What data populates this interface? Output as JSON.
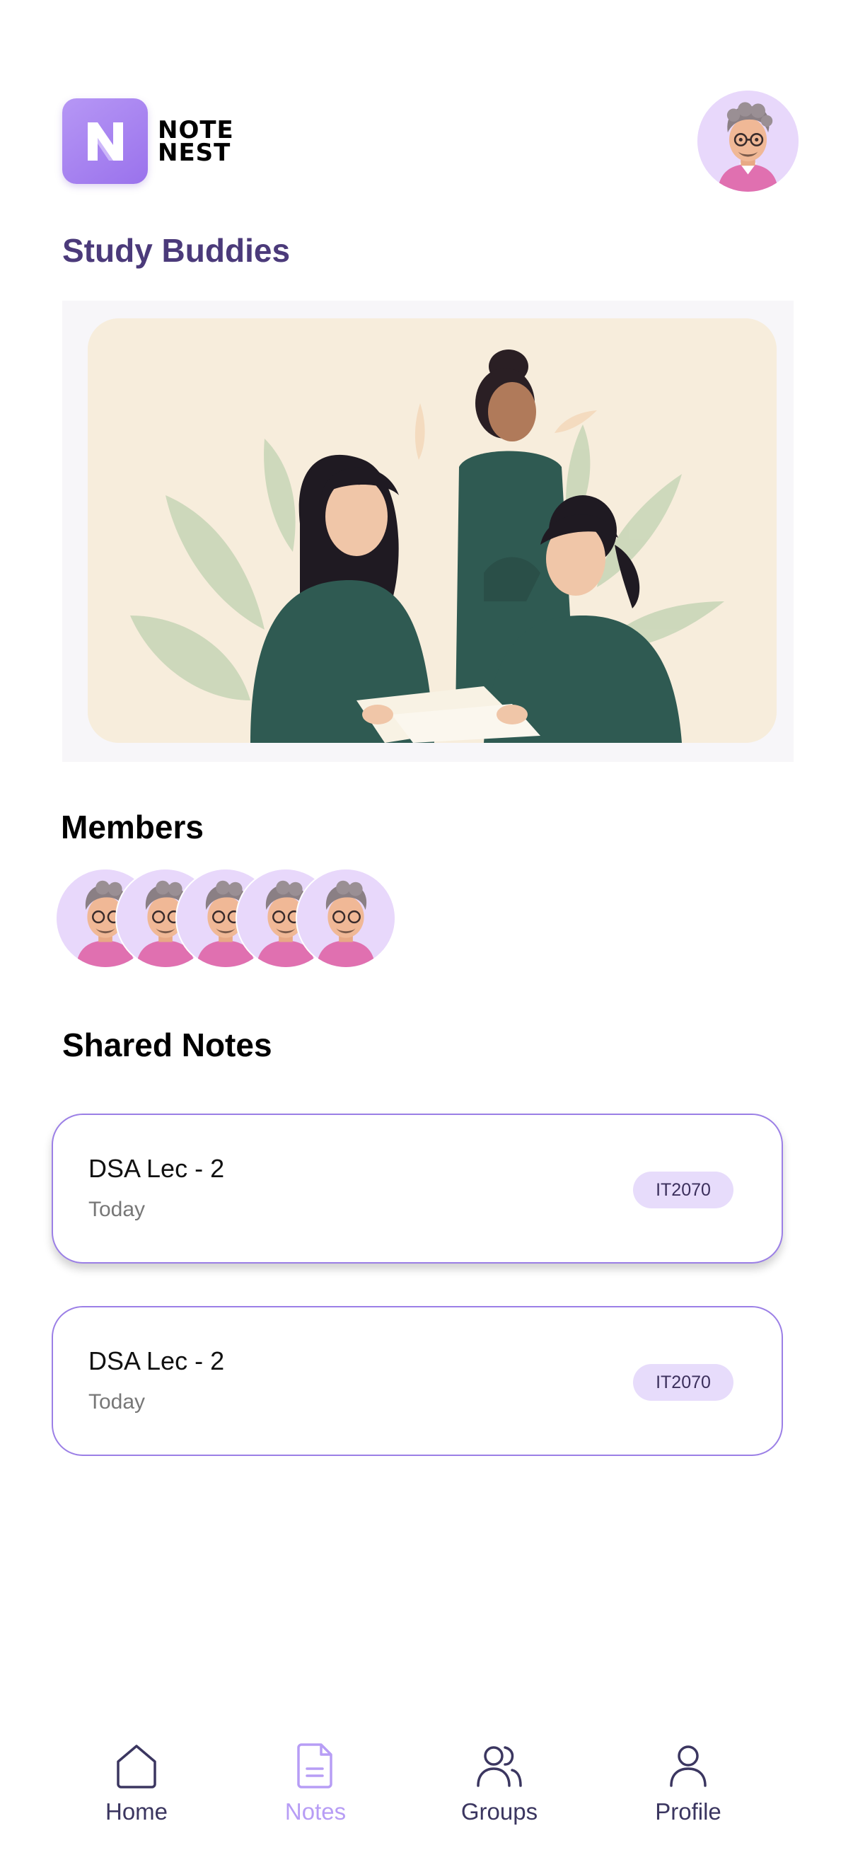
{
  "app": {
    "logo_line1": "NOTE",
    "logo_line2": "NEST",
    "logo_letter": "N"
  },
  "group": {
    "title": "Study Buddies"
  },
  "members": {
    "title": "Members",
    "count": 5
  },
  "shared_notes": {
    "title": "Shared Notes",
    "items": [
      {
        "name": "DSA Lec - 2",
        "date": "Today",
        "badge": "IT2070"
      },
      {
        "name": "DSA Lec - 2",
        "date": "Today",
        "badge": "IT2070"
      }
    ]
  },
  "bottom_nav": {
    "items": [
      {
        "label": "Home",
        "icon": "home-icon"
      },
      {
        "label": "Notes",
        "icon": "document-icon"
      },
      {
        "label": "Groups",
        "icon": "users-icon"
      },
      {
        "label": "Profile",
        "icon": "user-icon"
      }
    ],
    "active": "Notes"
  },
  "colors": {
    "accent": "#9b7fe6",
    "active_nav": "#b79df5",
    "title_purple": "#4b3a7a",
    "badge_bg": "#e7dcfb"
  }
}
